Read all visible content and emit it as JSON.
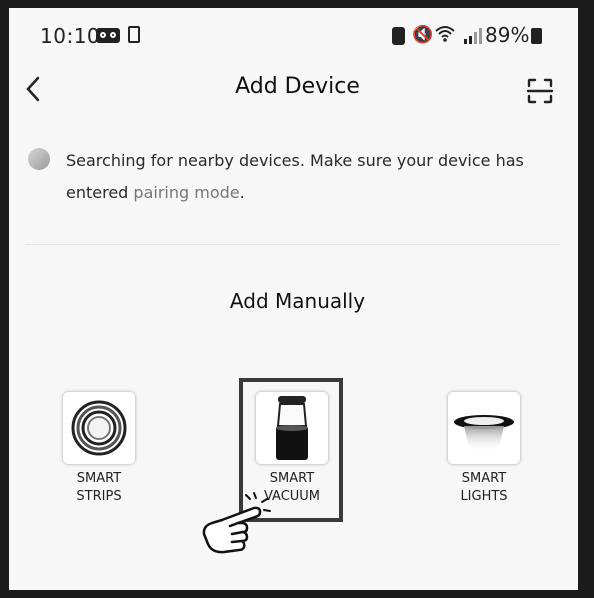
{
  "status_bar": {
    "time": "10:10",
    "battery_percent": "89%",
    "icons": [
      "voicemail-icon",
      "clipboard-icon",
      "battery-save-icon",
      "mute-icon",
      "wifi-icon",
      "signal-icon",
      "battery-icon"
    ]
  },
  "header": {
    "title": "Add Device",
    "back_icon": "chevron-left-icon",
    "scan_icon": "scan-icon"
  },
  "search": {
    "message": "Searching for nearby devices. Make sure your device has entered",
    "link_text": "pairing mode",
    "suffix": "."
  },
  "add_manually": {
    "heading": "Add Manually",
    "devices": [
      {
        "line1": "SMART",
        "line2": "STRIPS"
      },
      {
        "line1": "SMART",
        "line2": "VACUUM"
      },
      {
        "line1": "SMART",
        "line2": "LIGHTS"
      }
    ]
  },
  "colors": {
    "background": "#f7f7f7",
    "text": "#111111",
    "link": "#777777",
    "frame": "#1b1b1b"
  }
}
